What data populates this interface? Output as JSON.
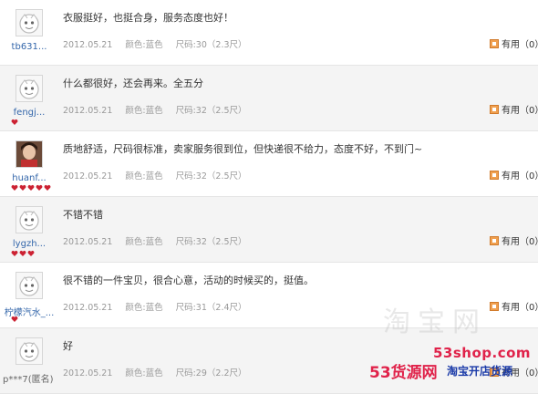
{
  "reviews": [
    {
      "user": "tb631...",
      "comment": "衣服挺好，也挺合身，服务态度也好！",
      "date": "2012.05.21",
      "color": "颜色:蓝色",
      "size": "尺码:30（2.3尺）",
      "useful": "有用（0）",
      "badges": 0,
      "photo": false
    },
    {
      "user": "fengj...",
      "comment": "什么都很好，还会再来。全五分",
      "date": "2012.05.21",
      "color": "颜色:蓝色",
      "size": "尺码:32（2.5尺）",
      "useful": "有用（0）",
      "badges": 1,
      "photo": false
    },
    {
      "user": "huanf...",
      "comment": "质地舒适，尺码很标准，卖家服务很到位，但快递很不给力，态度不好，不到门~",
      "date": "2012.05.21",
      "color": "颜色:蓝色",
      "size": "尺码:32（2.5尺）",
      "useful": "有用（0）",
      "badges": 5,
      "photo": true
    },
    {
      "user": "lygzh...",
      "comment": "不错不错",
      "date": "2012.05.21",
      "color": "颜色:蓝色",
      "size": "尺码:32（2.5尺）",
      "useful": "有用（0）",
      "badges": 3,
      "photo": false
    },
    {
      "user": "柠檬汽水_...",
      "comment": "很不错的一件宝贝，很合心意，活动的时候买的，挺值。",
      "date": "2012.05.21",
      "color": "颜色:蓝色",
      "size": "尺码:31（2.4尺）",
      "useful": "有用（0）",
      "badges": 1,
      "photo": false
    },
    {
      "user": "",
      "comment": "好",
      "date": "2012.05.21",
      "color": "颜色:蓝色",
      "size": "尺码:29（2.2尺）",
      "useful": "有用（0）",
      "badges": 0,
      "photo": false
    }
  ],
  "footer_user": "p***7(匿名)",
  "watermark": {
    "site": "53shop.com",
    "brand": "53货源网",
    "tagline": "淘宝开店货源",
    "taobao": "淘宝网"
  },
  "colors": {
    "accent": "#e0224a",
    "link": "#3366aa",
    "badge": "#cc2233",
    "useful_icon": "#f0a050"
  }
}
